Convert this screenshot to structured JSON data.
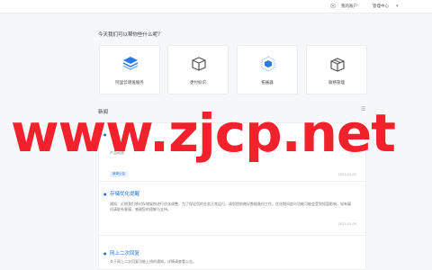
{
  "topbar": {
    "icon_label": "Ea",
    "user_label": "我的账户",
    "menu_label": "管理中心"
  },
  "intro": {
    "question": "今天我们可以帮你些什么呢？"
  },
  "cards": [
    {
      "label": "阿里云增值服务",
      "icon": "layers-icon",
      "color": "#2b7be4"
    },
    {
      "label": "更付标识",
      "icon": "box-icon",
      "color": "#555555"
    },
    {
      "label": "拓展器",
      "icon": "hex-icon",
      "color": "#2b7be4"
    },
    {
      "label": "联络管理",
      "icon": "package-icon",
      "color": "#555555"
    }
  ],
  "news": {
    "title": "新闻",
    "more_icon": "list-icon",
    "items": [
      {
        "title": "",
        "body": "产品动态",
        "tag": "新闻公告",
        "date": "2023-01-05"
      },
      {
        "title": "存储优化提醒",
        "body": "通知：近期我们将对存储架构进行优化调整，为了保证您的业务正常运行，请您提前做好数据备份工作，优化期间部分功能可能会受到短暂影响，如有疑问请联系客服，感谢您的理解与支持。",
        "tag": "新闻公告",
        "date": "2023-01-05"
      },
      {
        "title": "网上二次回复",
        "body": "关于网上二次回复功能上线的通知，详情请查看公告。",
        "tag": "",
        "date": ""
      }
    ]
  },
  "watermark": {
    "text": "www.zjcp.net",
    "color": "#f2212b"
  }
}
